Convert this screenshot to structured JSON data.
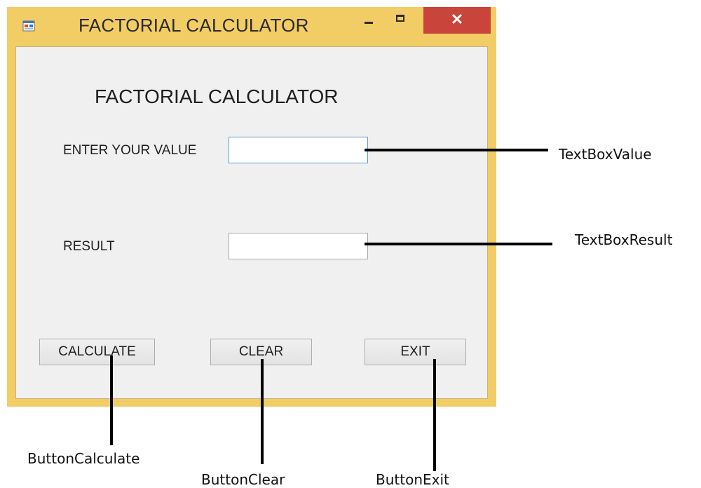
{
  "window": {
    "title": "FACTORIAL CALCULATOR",
    "controls": {
      "minimize_icon": "minimize-icon",
      "maximize_icon": "maximize-icon",
      "close_glyph": "✕"
    },
    "colors": {
      "frame": "#f2cd66",
      "close": "#c9443a",
      "client": "#f0f0f0"
    }
  },
  "form": {
    "heading": "FACTORIAL CALCULATOR",
    "value_label": "ENTER YOUR VALUE",
    "value_input": "",
    "result_label": "RESULT",
    "result_input": "",
    "buttons": {
      "calculate": "CALCULATE",
      "clear": "CLEAR",
      "exit": "EXIT"
    }
  },
  "annotations": {
    "textbox_value": "TextBoxValue",
    "textbox_result": "TextBoxResult",
    "button_calculate": "ButtonCalculate",
    "button_clear": "ButtonClear",
    "button_exit": "ButtonExit"
  }
}
